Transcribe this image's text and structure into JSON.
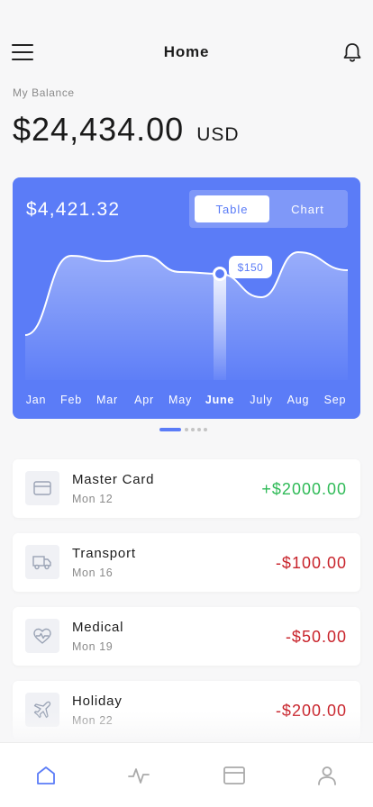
{
  "header": {
    "title": "Home",
    "menu_icon": "hamburger-menu-icon",
    "bell_icon": "bell-icon"
  },
  "balance": {
    "label": "My Balance",
    "amount": "$24,434.00",
    "currency": "USD"
  },
  "card": {
    "amount": "$4,421.32",
    "toggle": {
      "table_label": "Table",
      "chart_label": "Chart",
      "selected": "Table"
    },
    "accent_color": "#5b7cf7"
  },
  "chart_data": {
    "type": "area",
    "x": [
      "Jan",
      "Feb",
      "Mar",
      "Apr",
      "May",
      "June",
      "July",
      "Aug",
      "Sep"
    ],
    "highlight": {
      "category": "June",
      "label": "$150"
    },
    "series": [
      {
        "values": [
          40,
          128,
          122,
          128,
          110,
          108,
          82,
          132,
          112
        ]
      }
    ],
    "ylim": [
      0,
      160
    ],
    "grid": false
  },
  "pager": {
    "count": 5,
    "active": 0
  },
  "transactions": [
    {
      "name": "Master Card",
      "date": "Mon 12",
      "amount": "+$2000.00",
      "type": "credit",
      "icon": "credit-card-icon"
    },
    {
      "name": "Transport",
      "date": "Mon 16",
      "amount": "-$100.00",
      "type": "debit",
      "icon": "truck-icon"
    },
    {
      "name": "Medical",
      "date": "Mon 19",
      "amount": "-$50.00",
      "type": "debit",
      "icon": "heart-pulse-icon"
    },
    {
      "name": "Holiday",
      "date": "Mon 22",
      "amount": "-$200.00",
      "type": "debit",
      "icon": "airplane-icon"
    }
  ],
  "tabbar": {
    "items": [
      {
        "icon": "home-icon",
        "active": true
      },
      {
        "icon": "activity-icon",
        "active": false
      },
      {
        "icon": "card-icon",
        "active": false
      },
      {
        "icon": "user-icon",
        "active": false
      }
    ]
  },
  "colors": {
    "positive": "#2fba57",
    "negative": "#c8232b",
    "accent": "#5b7cf7"
  }
}
